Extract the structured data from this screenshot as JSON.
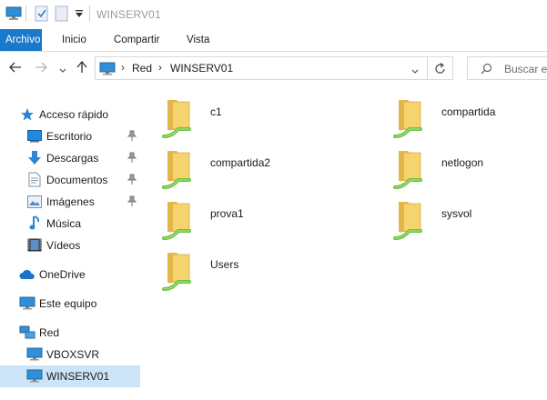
{
  "window": {
    "title": "WINSERV01"
  },
  "ribbon": {
    "tabs": [
      {
        "label": "Archivo"
      },
      {
        "label": "Inicio"
      },
      {
        "label": "Compartir"
      },
      {
        "label": "Vista"
      }
    ]
  },
  "address": {
    "crumbs": [
      {
        "label": "Red"
      },
      {
        "label": "WINSERV01"
      }
    ]
  },
  "search": {
    "placeholder": "Buscar en"
  },
  "nav": {
    "quick_access": {
      "label": "Acceso rápido"
    },
    "quick_items": [
      {
        "label": "Escritorio",
        "pinned": true
      },
      {
        "label": "Descargas",
        "pinned": true
      },
      {
        "label": "Documentos",
        "pinned": true
      },
      {
        "label": "Imágenes",
        "pinned": true
      },
      {
        "label": "Música",
        "pinned": false
      },
      {
        "label": "Vídeos",
        "pinned": false
      }
    ],
    "onedrive": {
      "label": "OneDrive"
    },
    "this_pc": {
      "label": "Este equipo"
    },
    "network": {
      "label": "Red"
    },
    "network_items": [
      {
        "label": "VBOXSVR"
      },
      {
        "label": "WINSERV01",
        "selected": true
      }
    ]
  },
  "shares": [
    {
      "name": "c1"
    },
    {
      "name": "compartida"
    },
    {
      "name": "compartida2"
    },
    {
      "name": "netlogon"
    },
    {
      "name": "prova1"
    },
    {
      "name": "sysvol"
    },
    {
      "name": "Users"
    }
  ],
  "colors": {
    "accent": "#1979ca",
    "selection": "#cce4f7",
    "folder": "#f5d36d",
    "share_pipe": "#6cbf3f"
  }
}
